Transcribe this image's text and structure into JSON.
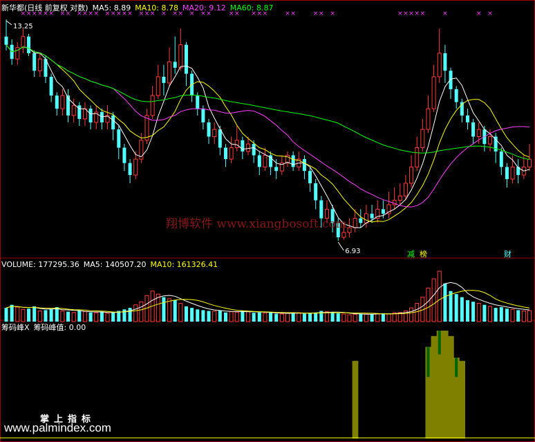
{
  "price_header": {
    "title": "新华都(日线 前复权 对数)",
    "ma5": "MA5: 8.89",
    "ma10": "MA10: 8.78",
    "ma20": "MA20: 9.12",
    "ma60": "MA60: 8.87"
  },
  "volume_header": {
    "title": "VOLUME: 177295.36",
    "ma5": "MA5: 140507.20",
    "ma10": "MA10: 161326.41"
  },
  "chip_header": {
    "title": "筹码峰X",
    "value": "筹码峰值: 0.00"
  },
  "annotations": {
    "high_label": "13.25",
    "low_label": "6.93",
    "tag_jian": "减",
    "tag_bang": "榜",
    "tag_cai": "财"
  },
  "watermark": "翔博软件 www.xiangbosoft.com",
  "brand": {
    "cn": "掌上指标",
    "en": "www.palmindex.com"
  },
  "colors": {
    "up": "#ff3b3b",
    "down": "#54ffff",
    "ma5": "#ffffff",
    "ma10": "#ffff00",
    "ma20": "#ff40ff",
    "ma60": "#00ff00",
    "chip_bar": "#808000",
    "chip_peak": "#006400",
    "marker": "#ff40ff"
  },
  "chart_data": {
    "type": "candlestick",
    "price_range": [
      6.93,
      13.25
    ],
    "log_scale": true,
    "candles": [
      [
        12.6,
        12.3,
        13.25,
        12.1
      ],
      [
        12.3,
        11.8,
        12.5,
        11.6
      ],
      [
        11.8,
        12.2,
        12.4,
        11.6
      ],
      [
        12.2,
        12.6,
        12.9,
        12.0
      ],
      [
        12.6,
        12.0,
        12.7,
        11.9
      ],
      [
        12.0,
        11.4,
        12.1,
        11.2
      ],
      [
        11.4,
        11.8,
        12.0,
        11.2
      ],
      [
        11.8,
        11.2,
        11.9,
        11.0
      ],
      [
        11.2,
        10.6,
        11.3,
        10.4
      ],
      [
        10.6,
        10.2,
        10.7,
        10.0
      ],
      [
        10.2,
        10.6,
        10.8,
        10.0
      ],
      [
        10.6,
        10.0,
        10.8,
        9.8
      ],
      [
        10.0,
        10.3,
        10.5,
        9.8
      ],
      [
        10.3,
        9.9,
        10.4,
        9.7
      ],
      [
        9.9,
        10.2,
        10.4,
        9.7
      ],
      [
        10.2,
        9.8,
        10.3,
        9.6
      ],
      [
        9.8,
        10.1,
        10.3,
        9.6
      ],
      [
        10.1,
        9.8,
        10.2,
        9.6
      ],
      [
        9.8,
        10.0,
        10.3,
        9.6
      ],
      [
        10.0,
        9.6,
        10.1,
        9.3
      ],
      [
        9.6,
        9.1,
        9.7,
        8.8
      ],
      [
        9.1,
        8.7,
        9.2,
        8.5
      ],
      [
        8.7,
        8.4,
        8.8,
        8.2
      ],
      [
        8.4,
        8.8,
        9.0,
        8.3
      ],
      [
        8.8,
        9.3,
        9.5,
        8.7
      ],
      [
        9.3,
        10.0,
        10.2,
        9.2
      ],
      [
        10.0,
        10.6,
        10.9,
        9.9
      ],
      [
        10.6,
        11.2,
        11.6,
        10.5
      ],
      [
        11.2,
        11.0,
        11.6,
        10.6
      ],
      [
        11.0,
        11.7,
        12.2,
        10.9
      ],
      [
        11.7,
        11.5,
        12.6,
        11.3
      ],
      [
        11.5,
        12.3,
        12.9,
        11.4
      ],
      [
        12.3,
        11.3,
        12.4,
        10.9
      ],
      [
        11.3,
        10.6,
        11.4,
        10.4
      ],
      [
        10.6,
        10.2,
        10.7,
        10.0
      ],
      [
        10.2,
        9.8,
        10.3,
        9.6
      ],
      [
        9.8,
        9.4,
        9.9,
        9.2
      ],
      [
        9.4,
        9.6,
        9.8,
        9.2
      ],
      [
        9.6,
        9.1,
        9.7,
        8.9
      ],
      [
        9.1,
        8.8,
        9.2,
        8.6
      ],
      [
        8.8,
        9.1,
        9.4,
        8.7
      ],
      [
        9.1,
        9.3,
        9.7,
        9.0
      ],
      [
        9.3,
        9.0,
        9.4,
        8.8
      ],
      [
        9.0,
        9.2,
        9.4,
        8.9
      ],
      [
        9.2,
        8.9,
        9.3,
        8.7
      ],
      [
        8.9,
        8.6,
        9.0,
        8.4
      ],
      [
        8.6,
        8.9,
        9.1,
        8.5
      ],
      [
        8.9,
        8.6,
        9.0,
        8.4
      ],
      [
        8.6,
        8.5,
        8.8,
        8.3
      ],
      [
        8.5,
        8.7,
        8.9,
        8.4
      ],
      [
        8.7,
        8.9,
        9.0,
        8.6
      ],
      [
        8.9,
        8.6,
        9.0,
        8.5
      ],
      [
        8.6,
        8.8,
        9.0,
        8.5
      ],
      [
        8.8,
        8.5,
        8.9,
        8.3
      ],
      [
        8.5,
        8.2,
        8.6,
        8.0
      ],
      [
        8.2,
        7.8,
        8.3,
        7.6
      ],
      [
        7.8,
        7.4,
        7.9,
        7.2
      ],
      [
        7.4,
        7.6,
        7.8,
        7.3
      ],
      [
        7.6,
        7.3,
        7.7,
        7.1
      ],
      [
        7.3,
        7.0,
        7.4,
        6.93
      ],
      [
        7.0,
        7.1,
        7.3,
        6.95
      ],
      [
        7.1,
        7.2,
        7.4,
        7.0
      ],
      [
        7.2,
        7.4,
        7.6,
        7.1
      ],
      [
        7.4,
        7.3,
        7.6,
        7.2
      ],
      [
        7.3,
        7.5,
        7.7,
        7.2
      ],
      [
        7.5,
        7.4,
        7.7,
        7.3
      ],
      [
        7.4,
        7.6,
        7.8,
        7.3
      ],
      [
        7.6,
        7.5,
        7.8,
        7.4
      ],
      [
        7.5,
        7.7,
        8.0,
        7.4
      ],
      [
        7.7,
        7.8,
        8.1,
        7.6
      ],
      [
        7.8,
        7.9,
        8.2,
        7.7
      ],
      [
        7.9,
        8.2,
        8.4,
        7.8
      ],
      [
        8.2,
        8.6,
        8.9,
        8.1
      ],
      [
        8.6,
        9.1,
        9.4,
        8.5
      ],
      [
        9.1,
        9.6,
        9.9,
        9.0
      ],
      [
        9.6,
        10.2,
        10.6,
        9.5
      ],
      [
        10.2,
        11.2,
        11.6,
        10.1
      ],
      [
        11.2,
        12.0,
        12.9,
        11.0
      ],
      [
        12.0,
        11.4,
        12.3,
        11.0
      ],
      [
        11.4,
        10.8,
        11.5,
        10.5
      ],
      [
        10.8,
        10.4,
        10.9,
        10.2
      ],
      [
        10.4,
        10.0,
        10.5,
        9.8
      ],
      [
        10.0,
        9.8,
        10.2,
        9.6
      ],
      [
        9.8,
        9.4,
        9.9,
        9.2
      ],
      [
        9.4,
        9.6,
        9.8,
        9.2
      ],
      [
        9.6,
        9.2,
        9.7,
        9.0
      ],
      [
        9.2,
        9.4,
        9.6,
        9.0
      ],
      [
        9.4,
        9.0,
        9.5,
        8.7
      ],
      [
        9.0,
        8.6,
        9.1,
        8.4
      ],
      [
        8.6,
        8.3,
        8.7,
        8.1
      ],
      [
        8.3,
        8.6,
        8.9,
        8.2
      ],
      [
        8.6,
        8.4,
        8.8,
        8.2
      ],
      [
        8.4,
        8.6,
        8.9,
        8.3
      ],
      [
        8.6,
        8.8,
        9.2,
        8.5
      ]
    ],
    "volume_max": 330000,
    "volumes": [
      90000,
      110000,
      95000,
      80000,
      85000,
      100000,
      70000,
      75000,
      80000,
      95000,
      70000,
      65000,
      60000,
      72000,
      66000,
      60000,
      58000,
      62000,
      55000,
      60000,
      70000,
      80000,
      90000,
      110000,
      130000,
      170000,
      200000,
      180000,
      160000,
      150000,
      140000,
      120000,
      100000,
      90000,
      80000,
      75000,
      70000,
      68000,
      72000,
      60000,
      65000,
      62000,
      70000,
      66000,
      58000,
      60000,
      55000,
      60000,
      52000,
      50000,
      55000,
      60000,
      58000,
      52000,
      55000,
      60000,
      70000,
      65000,
      62000,
      55000,
      50000,
      45000,
      48000,
      52000,
      50000,
      48000,
      52000,
      55000,
      50000,
      58000,
      60000,
      70000,
      90000,
      120000,
      160000,
      220000,
      280000,
      330000,
      250000,
      200000,
      180000,
      160000,
      140000,
      130000,
      120000,
      110000,
      100000,
      90000,
      95000,
      85000,
      80000,
      75000,
      70000,
      72000
    ],
    "chip_levels": [
      0,
      0,
      0,
      0,
      0,
      0,
      0,
      0,
      0,
      0,
      0,
      0,
      0,
      0,
      0,
      0,
      0,
      0,
      0,
      0,
      0,
      0,
      0,
      0,
      0,
      0,
      0,
      0,
      0,
      0,
      0,
      0,
      0,
      0,
      0,
      0,
      0,
      0,
      0,
      0,
      0,
      0,
      0,
      0,
      0,
      0,
      0,
      0,
      0,
      0,
      0,
      0,
      0,
      0,
      0,
      0,
      0,
      0,
      0,
      0,
      0,
      0,
      0.72,
      0,
      0,
      0,
      0,
      0,
      0,
      0,
      0,
      0,
      0,
      0,
      0,
      0.85,
      0.95,
      1.0,
      1.0,
      0.95,
      0.75,
      0.72,
      0,
      0,
      0,
      0,
      0,
      0,
      0,
      0,
      0,
      0,
      0,
      0
    ]
  }
}
